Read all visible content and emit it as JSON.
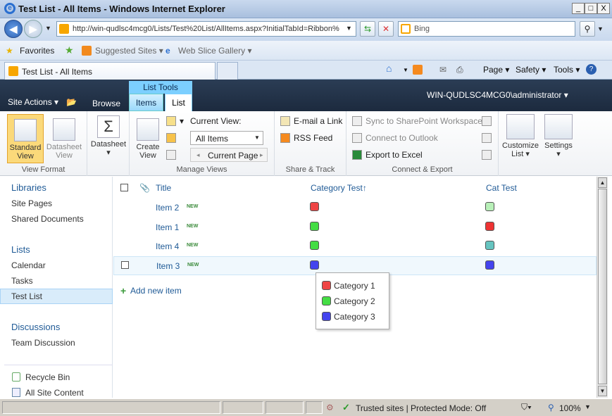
{
  "window": {
    "title": "Test List - All Items - Windows Internet Explorer",
    "min": "_",
    "max": "□",
    "close": "X"
  },
  "nav": {
    "address": "http://win-qudlsc4mcg0/Lists/Test%20List/AllItems.aspx?InitialTabId=Ribbon%",
    "search_placeholder": "Bing"
  },
  "favorites": {
    "label": "Favorites",
    "suggested": "Suggested Sites ▾",
    "webslice": "Web Slice Gallery ▾"
  },
  "tab": {
    "label": "Test List - All Items"
  },
  "commandbar": {
    "page": "Page ▾",
    "safety": "Safety ▾",
    "tools": "Tools ▾"
  },
  "sp": {
    "site_actions": "Site Actions ▾",
    "browse": "Browse",
    "list_tools": "List Tools",
    "tab_items": "Items",
    "tab_list": "List",
    "user": "WIN-QUDLSC4MCG0\\administrator ▾"
  },
  "ribbon": {
    "standard_view": "Standard\nView",
    "datasheet_view": "Datasheet\nView",
    "datasheet": "Datasheet",
    "create_view": "Create\nView",
    "current_view_label": "Current View:",
    "current_view_value": "All Items",
    "current_page": "Current Page",
    "email_link": "E-mail a Link",
    "rss": "RSS Feed",
    "sync_sp": "Sync to SharePoint Workspace",
    "connect_outlook": "Connect to Outlook",
    "export_excel": "Export to Excel",
    "customize_list": "Customize\nList ▾",
    "settings": "Settings\n▾",
    "groups": {
      "view_format": "View Format",
      "manage_views": "Manage Views",
      "share_track": "Share & Track",
      "connect_export": "Connect & Export"
    }
  },
  "leftnav": {
    "libraries": "Libraries",
    "site_pages": "Site Pages",
    "shared_documents": "Shared Documents",
    "lists": "Lists",
    "calendar": "Calendar",
    "tasks": "Tasks",
    "test_list": "Test List",
    "discussions": "Discussions",
    "team_discussion": "Team Discussion",
    "recycle_bin": "Recycle Bin",
    "all_site_content": "All Site Content"
  },
  "list": {
    "headers": {
      "title": "Title",
      "category": "Category Test↑",
      "cat": "Cat Test"
    },
    "rows": [
      {
        "title": "Item 2",
        "new": "NEW",
        "cat_color": "#ee4444",
        "cat2_color": "#b8f0b8"
      },
      {
        "title": "Item 1",
        "new": "NEW",
        "cat_color": "#44dd44",
        "cat2_color": "#ee3333"
      },
      {
        "title": "Item 4",
        "new": "NEW",
        "cat_color": "#44dd44",
        "cat2_color": "#66c4c0"
      },
      {
        "title": "Item 3",
        "new": "NEW",
        "cat_color": "#4444ee",
        "cat2_color": "#4444ee"
      }
    ],
    "add_new": "Add new item",
    "popup": [
      {
        "label": "Category 1",
        "color": "#ee4444"
      },
      {
        "label": "Category 2",
        "color": "#44dd44"
      },
      {
        "label": "Category 3",
        "color": "#4444ee"
      }
    ]
  },
  "status": {
    "zone": "Trusted sites | Protected Mode: Off",
    "zoom": "100%"
  }
}
